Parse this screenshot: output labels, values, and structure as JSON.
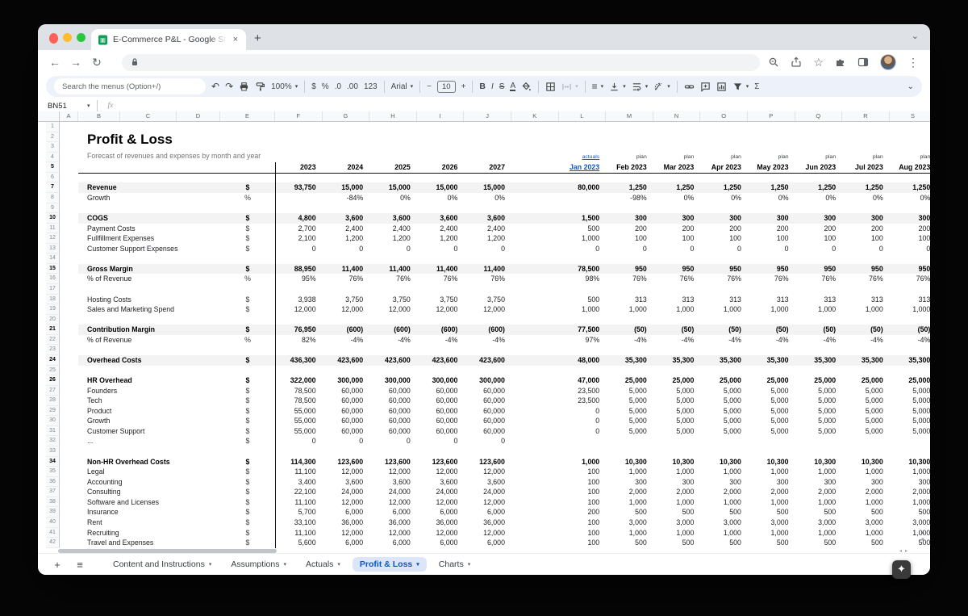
{
  "browser": {
    "tab_title": "E-Commerce P&L - Google Sh",
    "close_glyph": "×",
    "new_tab_glyph": "+",
    "back_glyph": "←",
    "forward_glyph": "→",
    "reload_glyph": "↻",
    "kebab_glyph": "⋮",
    "star_glyph": "☆",
    "chevron_glyph": "⌄"
  },
  "toolbar": {
    "search_placeholder": "Search the menus (Option+/)",
    "undo_glyph": "↶",
    "redo_glyph": "↷",
    "zoom_value": "100%",
    "currency_label": "$",
    "percent_label": "%",
    "dec_decrease_label": ".0",
    "dec_increase_label": ".00",
    "more_formats_label": "123",
    "font_name": "Arial",
    "minus_label": "−",
    "font_size": "10",
    "plus_label": "+",
    "bold_label": "B",
    "italic_label": "I",
    "strike_label": "S",
    "text_color_label": "A",
    "align_glyph": "≡",
    "sigma_label": "Σ",
    "collapse_glyph": "⌄"
  },
  "formula_bar": {
    "name_box_value": "BN51",
    "fx_label": "fx",
    "caret_glyph": "▾"
  },
  "sheet": {
    "column_letters": [
      "A",
      "B",
      "C",
      "D",
      "E",
      "F",
      "G",
      "H",
      "I",
      "J",
      "K",
      "L",
      "M",
      "N",
      "O",
      "P",
      "Q",
      "R",
      "S"
    ],
    "row_count": 42,
    "title": "Profit & Loss",
    "subtitle": "Forecast of revenues and expenses by month and year",
    "header": {
      "actuals_label": "actuals",
      "plan_label": "plan",
      "years": [
        "2023",
        "2024",
        "2025",
        "2026",
        "2027"
      ],
      "months": [
        "Jan 2023",
        "Feb 2023",
        "Mar 2023",
        "Apr 2023",
        "May 2023",
        "Jun 2023",
        "Jul 2023",
        "Aug 2023"
      ]
    },
    "rows": [
      {
        "n": 7,
        "label": "Revenue",
        "unit": "$",
        "style": "section",
        "years": [
          "93,750",
          "15,000",
          "15,000",
          "15,000",
          "15,000"
        ],
        "months": [
          "80,000",
          "1,250",
          "1,250",
          "1,250",
          "1,250",
          "1,250",
          "1,250",
          "1,250"
        ]
      },
      {
        "n": 8,
        "label": "Growth",
        "unit": "%",
        "style": "",
        "years": [
          "",
          "-84%",
          "0%",
          "0%",
          "0%"
        ],
        "months": [
          "",
          "-98%",
          "0%",
          "0%",
          "0%",
          "0%",
          "0%",
          "0%"
        ]
      },
      {
        "n": 10,
        "label": "COGS",
        "unit": "$",
        "style": "section",
        "years": [
          "4,800",
          "3,600",
          "3,600",
          "3,600",
          "3,600"
        ],
        "months": [
          "1,500",
          "300",
          "300",
          "300",
          "300",
          "300",
          "300",
          "300"
        ]
      },
      {
        "n": 11,
        "label": "Payment Costs",
        "unit": "$",
        "style": "",
        "years": [
          "2,700",
          "2,400",
          "2,400",
          "2,400",
          "2,400"
        ],
        "months": [
          "500",
          "200",
          "200",
          "200",
          "200",
          "200",
          "200",
          "200"
        ]
      },
      {
        "n": 12,
        "label": "Fullfillment Expenses",
        "unit": "$",
        "style": "",
        "years": [
          "2,100",
          "1,200",
          "1,200",
          "1,200",
          "1,200"
        ],
        "months": [
          "1,000",
          "100",
          "100",
          "100",
          "100",
          "100",
          "100",
          "100"
        ]
      },
      {
        "n": 13,
        "label": "Customer Support Expenses",
        "unit": "$",
        "style": "",
        "years": [
          "0",
          "0",
          "0",
          "0",
          "0"
        ],
        "months": [
          "0",
          "0",
          "0",
          "0",
          "0",
          "0",
          "0",
          "0"
        ]
      },
      {
        "n": 15,
        "label": "Gross Margin",
        "unit": "$",
        "style": "section",
        "years": [
          "88,950",
          "11,400",
          "11,400",
          "11,400",
          "11,400"
        ],
        "months": [
          "78,500",
          "950",
          "950",
          "950",
          "950",
          "950",
          "950",
          "950"
        ]
      },
      {
        "n": 16,
        "label": "% of Revenue",
        "unit": "%",
        "style": "",
        "years": [
          "95%",
          "76%",
          "76%",
          "76%",
          "76%"
        ],
        "months": [
          "98%",
          "76%",
          "76%",
          "76%",
          "76%",
          "76%",
          "76%",
          "76%"
        ]
      },
      {
        "n": 18,
        "label": "Hosting Costs",
        "unit": "$",
        "style": "",
        "years": [
          "3,938",
          "3,750",
          "3,750",
          "3,750",
          "3,750"
        ],
        "months": [
          "500",
          "313",
          "313",
          "313",
          "313",
          "313",
          "313",
          "313"
        ]
      },
      {
        "n": 19,
        "label": "Sales and Marketing Spend",
        "unit": "$",
        "style": "",
        "years": [
          "12,000",
          "12,000",
          "12,000",
          "12,000",
          "12,000"
        ],
        "months": [
          "1,000",
          "1,000",
          "1,000",
          "1,000",
          "1,000",
          "1,000",
          "1,000",
          "1,000"
        ]
      },
      {
        "n": 21,
        "label": "Contribution Margin",
        "unit": "$",
        "style": "section",
        "years": [
          "76,950",
          "(600)",
          "(600)",
          "(600)",
          "(600)"
        ],
        "months": [
          "77,500",
          "(50)",
          "(50)",
          "(50)",
          "(50)",
          "(50)",
          "(50)",
          "(50)"
        ]
      },
      {
        "n": 22,
        "label": "% of Revenue",
        "unit": "%",
        "style": "",
        "years": [
          "82%",
          "-4%",
          "-4%",
          "-4%",
          "-4%"
        ],
        "months": [
          "97%",
          "-4%",
          "-4%",
          "-4%",
          "-4%",
          "-4%",
          "-4%",
          "-4%"
        ]
      },
      {
        "n": 24,
        "label": "Overhead Costs",
        "unit": "$",
        "style": "section",
        "years": [
          "436,300",
          "423,600",
          "423,600",
          "423,600",
          "423,600"
        ],
        "months": [
          "48,000",
          "35,300",
          "35,300",
          "35,300",
          "35,300",
          "35,300",
          "35,300",
          "35,300"
        ]
      },
      {
        "n": 26,
        "label": "HR Overhead",
        "unit": "$",
        "style": "subtotal",
        "years": [
          "322,000",
          "300,000",
          "300,000",
          "300,000",
          "300,000"
        ],
        "months": [
          "47,000",
          "25,000",
          "25,000",
          "25,000",
          "25,000",
          "25,000",
          "25,000",
          "25,000"
        ]
      },
      {
        "n": 27,
        "label": "Founders",
        "unit": "$",
        "style": "",
        "years": [
          "78,500",
          "60,000",
          "60,000",
          "60,000",
          "60,000"
        ],
        "months": [
          "23,500",
          "5,000",
          "5,000",
          "5,000",
          "5,000",
          "5,000",
          "5,000",
          "5,000"
        ]
      },
      {
        "n": 28,
        "label": "Tech",
        "unit": "$",
        "style": "",
        "years": [
          "78,500",
          "60,000",
          "60,000",
          "60,000",
          "60,000"
        ],
        "months": [
          "23,500",
          "5,000",
          "5,000",
          "5,000",
          "5,000",
          "5,000",
          "5,000",
          "5,000"
        ]
      },
      {
        "n": 29,
        "label": "Product",
        "unit": "$",
        "style": "",
        "years": [
          "55,000",
          "60,000",
          "60,000",
          "60,000",
          "60,000"
        ],
        "months": [
          "0",
          "5,000",
          "5,000",
          "5,000",
          "5,000",
          "5,000",
          "5,000",
          "5,000"
        ]
      },
      {
        "n": 30,
        "label": "Growth",
        "unit": "$",
        "style": "",
        "years": [
          "55,000",
          "60,000",
          "60,000",
          "60,000",
          "60,000"
        ],
        "months": [
          "0",
          "5,000",
          "5,000",
          "5,000",
          "5,000",
          "5,000",
          "5,000",
          "5,000"
        ]
      },
      {
        "n": 31,
        "label": "Customer Support",
        "unit": "$",
        "style": "",
        "years": [
          "55,000",
          "60,000",
          "60,000",
          "60,000",
          "60,000"
        ],
        "months": [
          "0",
          "5,000",
          "5,000",
          "5,000",
          "5,000",
          "5,000",
          "5,000",
          "5,000"
        ]
      },
      {
        "n": 32,
        "label": "...",
        "unit": "$",
        "style": "",
        "years": [
          "0",
          "0",
          "0",
          "0",
          "0"
        ],
        "months": [
          "",
          "",
          "",
          "",
          "",
          "",
          "",
          ""
        ]
      },
      {
        "n": 34,
        "label": "Non-HR Overhead Costs",
        "unit": "$",
        "style": "subtotal",
        "years": [
          "114,300",
          "123,600",
          "123,600",
          "123,600",
          "123,600"
        ],
        "months": [
          "1,000",
          "10,300",
          "10,300",
          "10,300",
          "10,300",
          "10,300",
          "10,300",
          "10,300"
        ]
      },
      {
        "n": 35,
        "label": "Legal",
        "unit": "$",
        "style": "",
        "years": [
          "11,100",
          "12,000",
          "12,000",
          "12,000",
          "12,000"
        ],
        "months": [
          "100",
          "1,000",
          "1,000",
          "1,000",
          "1,000",
          "1,000",
          "1,000",
          "1,000"
        ]
      },
      {
        "n": 36,
        "label": "Accounting",
        "unit": "$",
        "style": "",
        "years": [
          "3,400",
          "3,600",
          "3,600",
          "3,600",
          "3,600"
        ],
        "months": [
          "100",
          "300",
          "300",
          "300",
          "300",
          "300",
          "300",
          "300"
        ]
      },
      {
        "n": 37,
        "label": "Consulting",
        "unit": "$",
        "style": "",
        "years": [
          "22,100",
          "24,000",
          "24,000",
          "24,000",
          "24,000"
        ],
        "months": [
          "100",
          "2,000",
          "2,000",
          "2,000",
          "2,000",
          "2,000",
          "2,000",
          "2,000"
        ]
      },
      {
        "n": 38,
        "label": "Software and Licenses",
        "unit": "$",
        "style": "",
        "years": [
          "11,100",
          "12,000",
          "12,000",
          "12,000",
          "12,000"
        ],
        "months": [
          "100",
          "1,000",
          "1,000",
          "1,000",
          "1,000",
          "1,000",
          "1,000",
          "1,000"
        ]
      },
      {
        "n": 39,
        "label": "Insurance",
        "unit": "$",
        "style": "",
        "years": [
          "5,700",
          "6,000",
          "6,000",
          "6,000",
          "6,000"
        ],
        "months": [
          "200",
          "500",
          "500",
          "500",
          "500",
          "500",
          "500",
          "500"
        ]
      },
      {
        "n": 40,
        "label": "Rent",
        "unit": "$",
        "style": "",
        "years": [
          "33,100",
          "36,000",
          "36,000",
          "36,000",
          "36,000"
        ],
        "months": [
          "100",
          "3,000",
          "3,000",
          "3,000",
          "3,000",
          "3,000",
          "3,000",
          "3,000"
        ]
      },
      {
        "n": 41,
        "label": "Recruiting",
        "unit": "$",
        "style": "",
        "years": [
          "11,100",
          "12,000",
          "12,000",
          "12,000",
          "12,000"
        ],
        "months": [
          "100",
          "1,000",
          "1,000",
          "1,000",
          "1,000",
          "1,000",
          "1,000",
          "1,000"
        ]
      },
      {
        "n": 42,
        "label": "Travel and Expenses",
        "unit": "$",
        "style": "",
        "years": [
          "5,600",
          "6,000",
          "6,000",
          "6,000",
          "6,000"
        ],
        "months": [
          "100",
          "500",
          "500",
          "500",
          "500",
          "500",
          "500",
          "500"
        ]
      }
    ]
  },
  "sheet_tabs": {
    "add_glyph": "+",
    "all_sheets_glyph": "≡",
    "caret_glyph": "▾",
    "items": [
      "Content and Instructions",
      "Assumptions",
      "Actuals",
      "Profit & Loss",
      "Charts"
    ],
    "active": "Profit & Loss"
  },
  "colors": {
    "link_blue": "#1155cc",
    "active_tab_blue": "#0b57d0",
    "section_band_gray": "#f3f3f3",
    "toolbar_bg": "#edf2fa",
    "sheets_green": "#0f9d58"
  }
}
